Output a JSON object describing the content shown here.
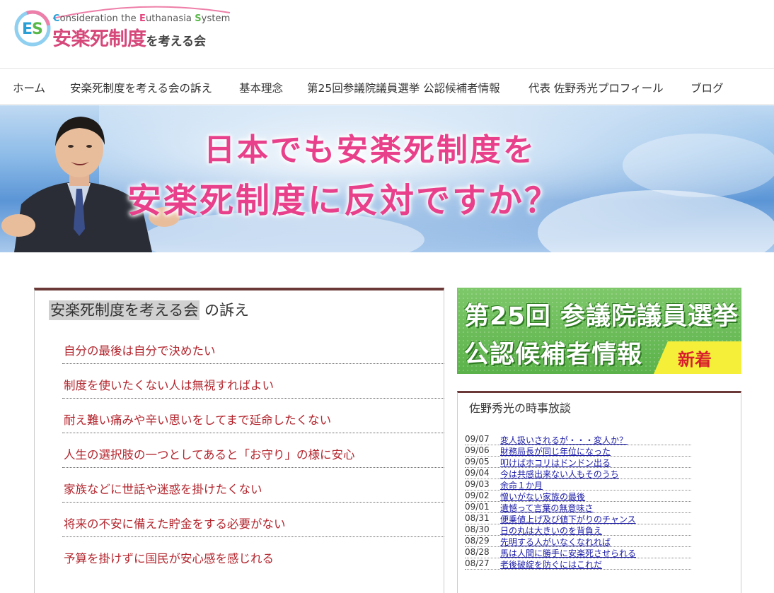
{
  "header": {
    "logo_en_parts": [
      "C",
      "onsideration the ",
      "E",
      "uthanasia ",
      "S",
      "ystem"
    ],
    "logo_jp_big": "安楽死制度",
    "logo_jp_small": "を考える会"
  },
  "nav": {
    "items": [
      {
        "label": "ホーム"
      },
      {
        "label": "安楽死制度を考える会の訴え"
      },
      {
        "label": "基本理念"
      },
      {
        "label": "第25回参議院議員選挙 公認候補者情報"
      },
      {
        "label": "代表 佐野秀光プロフィール"
      },
      {
        "label": "ブログ"
      }
    ]
  },
  "hero": {
    "line1": "日本でも安楽死制度を",
    "line2": "安楽死制度に反対ですか？"
  },
  "appeal": {
    "title_highlight": "安楽死制度を考える会",
    "title_rest": " の訴え",
    "items": [
      "自分の最後は自分で決めたい",
      "制度を使いたくない人は無視すればよい",
      "耐え難い痛みや辛い思いをしてまで延命したくない",
      "人生の選択肢の一つとしてあると「お守り」の様に安心",
      "家族などに世話や迷惑を掛けたくない",
      "将来の不安に備えた貯金をする必要がない",
      "予算を掛けずに国民が安心感を感じれる"
    ]
  },
  "banner": {
    "line1": "第25回 参議院議員選挙",
    "line2": "公認候補者情報",
    "badge": "新着"
  },
  "news": {
    "title": "佐野秀光の時事放談",
    "items": [
      {
        "date": "09/07",
        "title": "変人扱いされるが・・・変人か？"
      },
      {
        "date": "09/06",
        "title": "財務局長が同じ年位になった"
      },
      {
        "date": "09/05",
        "title": "叩けばホコリはドンドン出る"
      },
      {
        "date": "09/04",
        "title": "今は共感出来ない人もそのうち"
      },
      {
        "date": "09/03",
        "title": "余命１か月"
      },
      {
        "date": "09/02",
        "title": "憎いがない家族の最後"
      },
      {
        "date": "09/01",
        "title": "遺憾って言葉の無意味さ"
      },
      {
        "date": "08/31",
        "title": "便乗値上げ及び値下がりのチャンス"
      },
      {
        "date": "08/30",
        "title": "日の丸は大きいのを背負え"
      },
      {
        "date": "08/29",
        "title": "先明する人がいなくなれれば"
      },
      {
        "date": "08/28",
        "title": "馬は人間に勝手に安楽死させられる"
      },
      {
        "date": "08/27",
        "title": "老後破綻を防ぐにはこれだ"
      }
    ]
  }
}
